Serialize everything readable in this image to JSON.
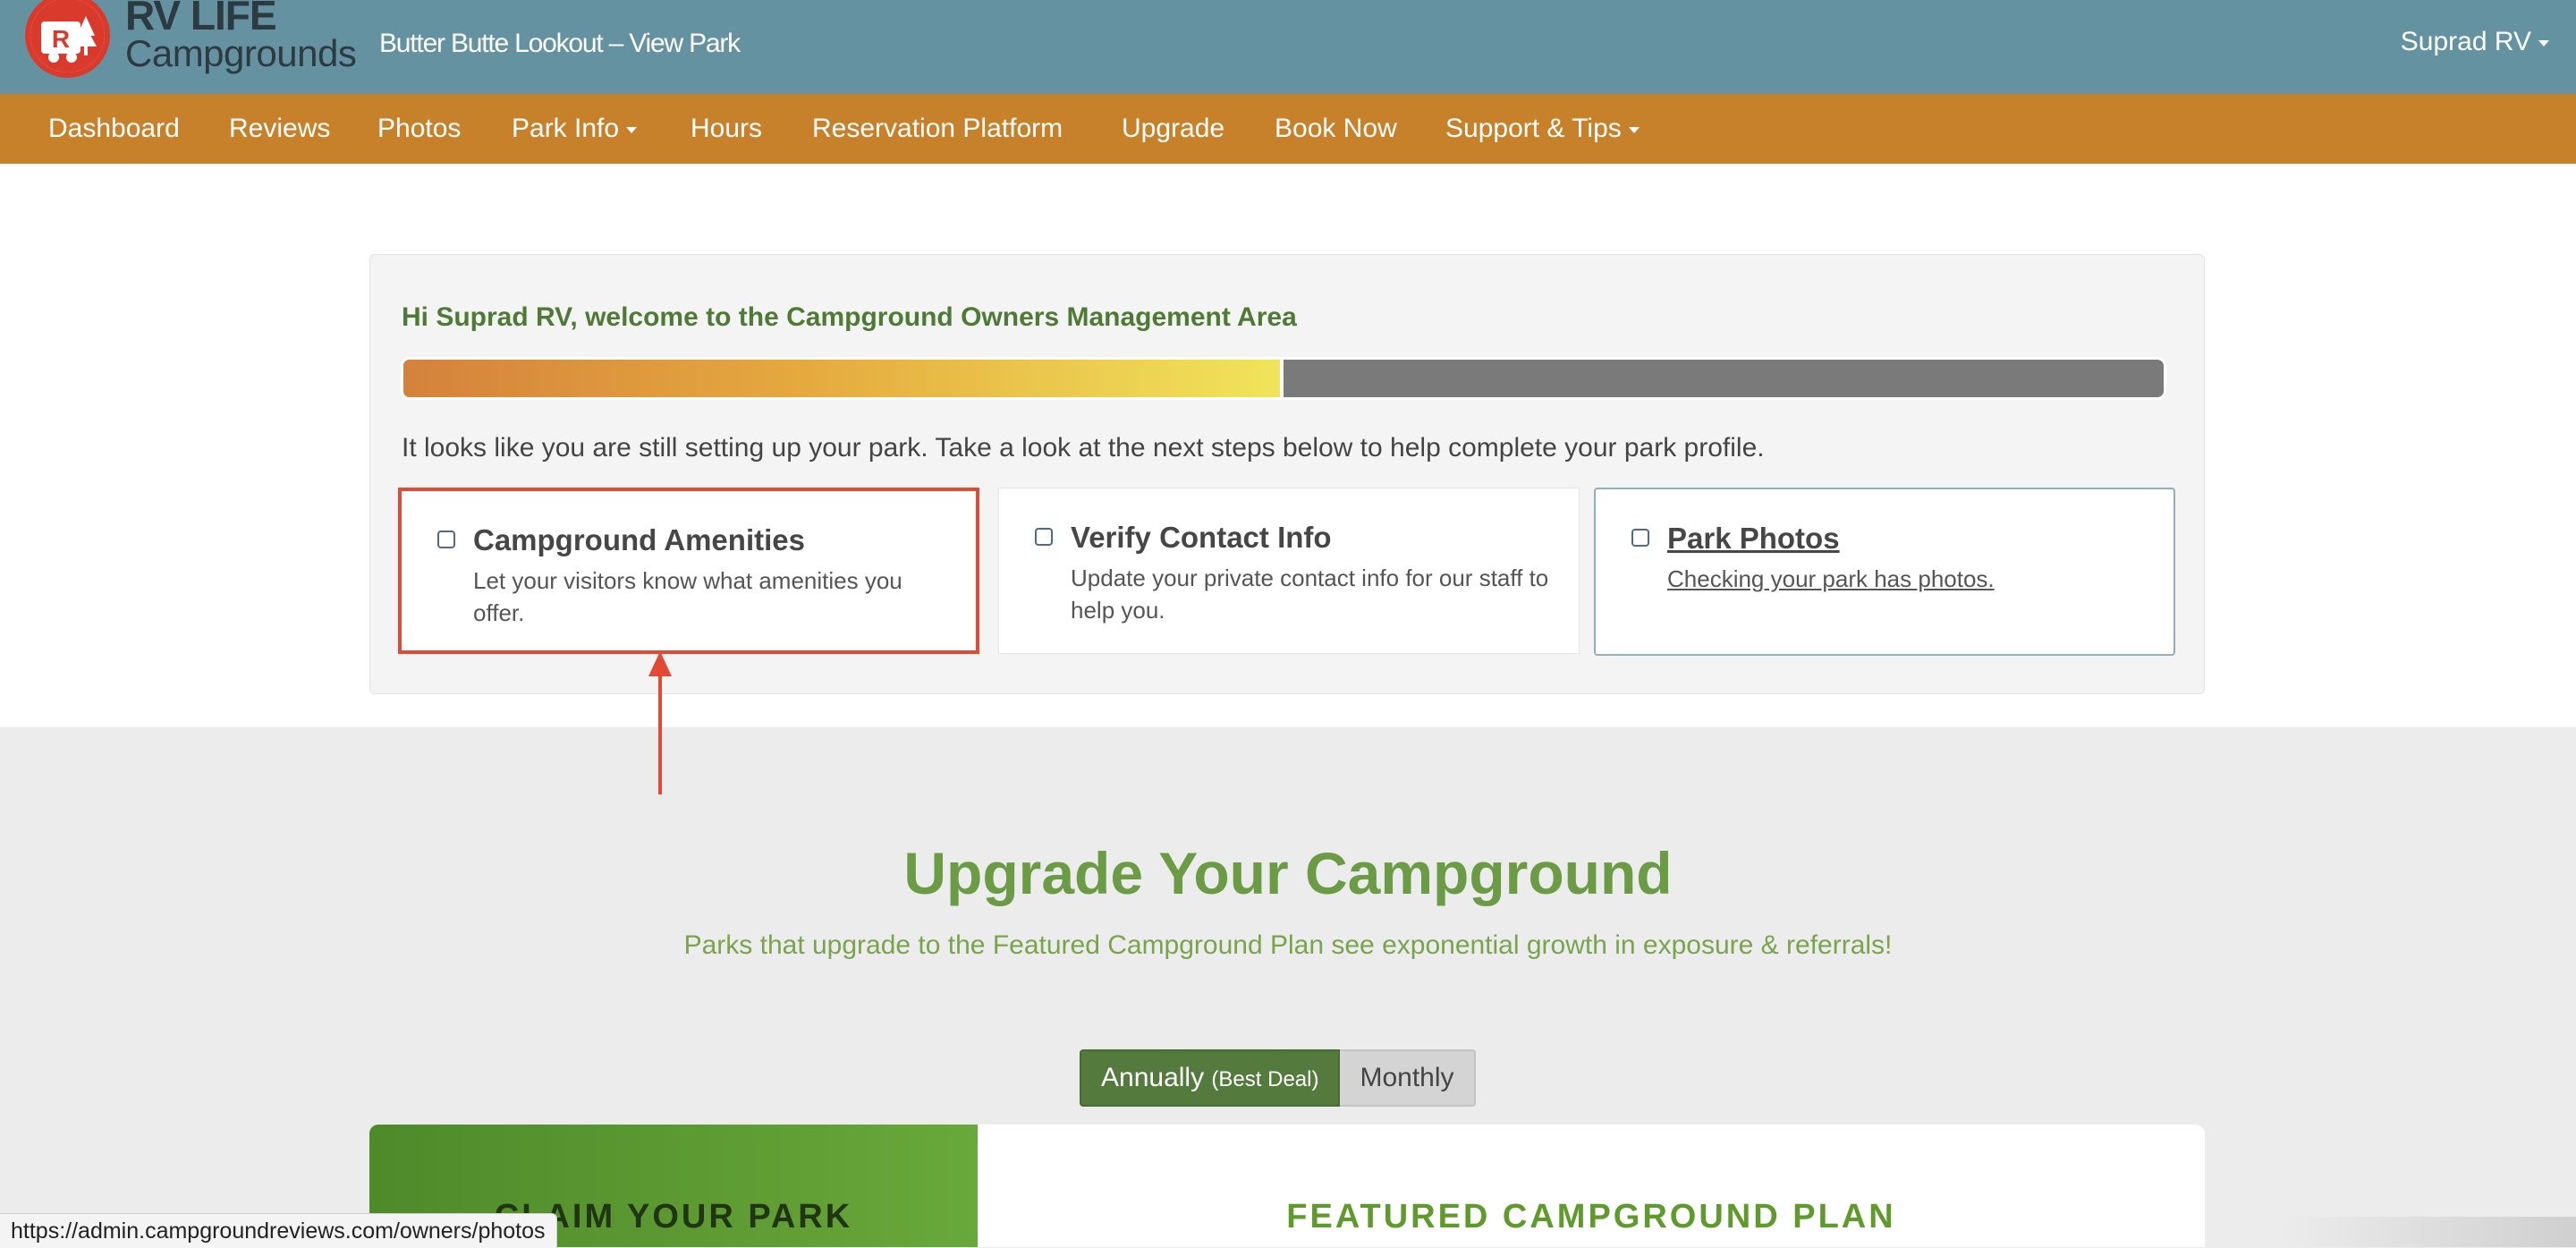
{
  "header": {
    "logo_line1": "RV LIFE",
    "logo_line2": "Campgrounds",
    "park_title": "Butter Butte Lookout – View Park",
    "user_menu": "Suprad RV"
  },
  "nav": {
    "items": [
      {
        "label": "Dashboard"
      },
      {
        "label": "Reviews"
      },
      {
        "label": "Photos"
      },
      {
        "label": "Park Info",
        "dropdown": true
      },
      {
        "label": "Hours"
      },
      {
        "label": "Reservation Platform"
      },
      {
        "label": "Upgrade"
      },
      {
        "label": "Book Now"
      },
      {
        "label": "Support & Tips",
        "dropdown": true
      }
    ]
  },
  "welcome": {
    "title": "Hi Suprad RV, welcome to the Campground Owners Management Area",
    "progress_fraction": 0.5,
    "setup_text": "It looks like you are still setting up your park. Take a look at the next steps below to help complete your park profile."
  },
  "steps": [
    {
      "title": "Campground Amenities",
      "desc": "Let your visitors know what amenities you offer.",
      "checked": false
    },
    {
      "title": "Verify Contact Info",
      "desc": "Update your private contact info for our staff to help you.",
      "checked": false
    },
    {
      "title": "Park Photos",
      "desc": "Checking your park has photos.",
      "checked": false
    }
  ],
  "upgrade": {
    "heading": "Upgrade Your Campground",
    "subheading": "Parks that upgrade to the Featured Campground Plan see exponential growth in exposure & referrals!",
    "toggle_annual": "Annually",
    "toggle_annual_note": "(Best Deal)",
    "toggle_monthly": "Monthly",
    "plan_claim_title": "CLAIM YOUR PARK",
    "plan_featured_title": "FEATURED CAMPGROUND PLAN"
  },
  "status_url": "https://admin.campgroundreviews.com/owners/photos",
  "colors": {
    "header_bg": "#6592a0",
    "nav_bg": "#c8812b",
    "accent_green": "#6c9b45",
    "highlight_red": "#e24a36"
  }
}
